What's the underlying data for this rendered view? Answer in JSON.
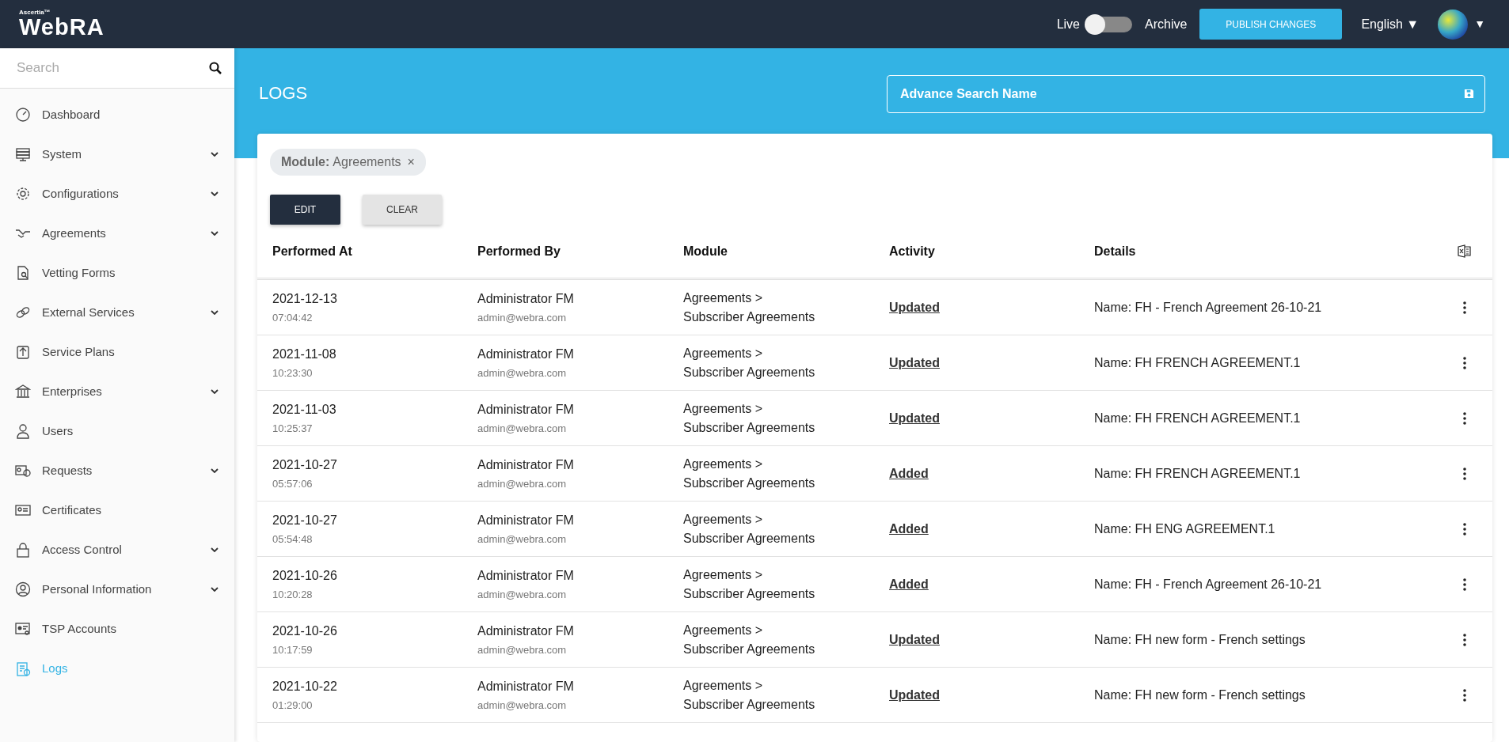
{
  "topbar": {
    "brand_small": "Ascertia™",
    "brand": "WebRA",
    "toggle": {
      "left_label": "Live",
      "right_label": "Archive",
      "on": false
    },
    "publish_button": "PUBLISH CHANGES",
    "language": "English ▼",
    "avatar_caret": "▼"
  },
  "sidebar": {
    "search": {
      "placeholder": "Search"
    },
    "items": [
      {
        "label": "Dashboard",
        "expandable": false,
        "selected": false
      },
      {
        "label": "System",
        "expandable": true,
        "selected": false
      },
      {
        "label": "Configurations",
        "expandable": true,
        "selected": false
      },
      {
        "label": "Agreements",
        "expandable": true,
        "selected": false
      },
      {
        "label": "Vetting Forms",
        "expandable": false,
        "selected": false
      },
      {
        "label": "External Services",
        "expandable": true,
        "selected": false
      },
      {
        "label": "Service Plans",
        "expandable": false,
        "selected": false
      },
      {
        "label": "Enterprises",
        "expandable": true,
        "selected": false
      },
      {
        "label": "Users",
        "expandable": false,
        "selected": false
      },
      {
        "label": "Requests",
        "expandable": true,
        "selected": false
      },
      {
        "label": "Certificates",
        "expandable": false,
        "selected": false
      },
      {
        "label": "Access Control",
        "expandable": true,
        "selected": false
      },
      {
        "label": "Personal Information",
        "expandable": true,
        "selected": false
      },
      {
        "label": "TSP Accounts",
        "expandable": false,
        "selected": false
      },
      {
        "label": "Logs",
        "expandable": false,
        "selected": true
      }
    ]
  },
  "page": {
    "title": "LOGS",
    "advance_search": {
      "placeholder": "Advance Search Name"
    }
  },
  "filters": [
    {
      "name": "Module:",
      "value": "Agreements",
      "remove": "×"
    }
  ],
  "buttons": [
    {
      "label": "EDIT",
      "kind": "primary"
    },
    {
      "label": "CLEAR",
      "kind": "secondary"
    }
  ],
  "table": {
    "columns": [
      "Performed At",
      "Performed By",
      "Module",
      "Activity",
      "Details"
    ],
    "rows": [
      {
        "date": "2021-12-13",
        "time": "07:04:42",
        "user": "Administrator FM",
        "email": "admin@webra.com",
        "module": "Agreements >",
        "submodule": "Subscriber Agreements",
        "activity": "Updated",
        "details": "Name: FH - French Agreement 26-10-21"
      },
      {
        "date": "2021-11-08",
        "time": "10:23:30",
        "user": "Administrator FM",
        "email": "admin@webra.com",
        "module": "Agreements >",
        "submodule": "Subscriber Agreements",
        "activity": "Updated",
        "details": "Name: FH FRENCH AGREEMENT.1"
      },
      {
        "date": "2021-11-03",
        "time": "10:25:37",
        "user": "Administrator FM",
        "email": "admin@webra.com",
        "module": "Agreements >",
        "submodule": "Subscriber Agreements",
        "activity": "Updated",
        "details": "Name: FH FRENCH AGREEMENT.1"
      },
      {
        "date": "2021-10-27",
        "time": "05:57:06",
        "user": "Administrator FM",
        "email": "admin@webra.com",
        "module": "Agreements >",
        "submodule": "Subscriber Agreements",
        "activity": "Added",
        "details": "Name: FH FRENCH AGREEMENT.1"
      },
      {
        "date": "2021-10-27",
        "time": "05:54:48",
        "user": "Administrator FM",
        "email": "admin@webra.com",
        "module": "Agreements >",
        "submodule": "Subscriber Agreements",
        "activity": "Added",
        "details": "Name: FH ENG AGREEMENT.1"
      },
      {
        "date": "2021-10-26",
        "time": "10:20:28",
        "user": "Administrator FM",
        "email": "admin@webra.com",
        "module": "Agreements >",
        "submodule": "Subscriber Agreements",
        "activity": "Added",
        "details": "Name: FH - French Agreement 26-10-21"
      },
      {
        "date": "2021-10-26",
        "time": "10:17:59",
        "user": "Administrator FM",
        "email": "admin@webra.com",
        "module": "Agreements >",
        "submodule": "Subscriber Agreements",
        "activity": "Updated",
        "details": "Name: FH new form - French settings"
      },
      {
        "date": "2021-10-22",
        "time": "01:29:00",
        "user": "Administrator FM",
        "email": "admin@webra.com",
        "module": "Agreements >",
        "submodule": "Subscriber Agreements",
        "activity": "Updated",
        "details": "Name: FH new form - French settings"
      }
    ]
  }
}
